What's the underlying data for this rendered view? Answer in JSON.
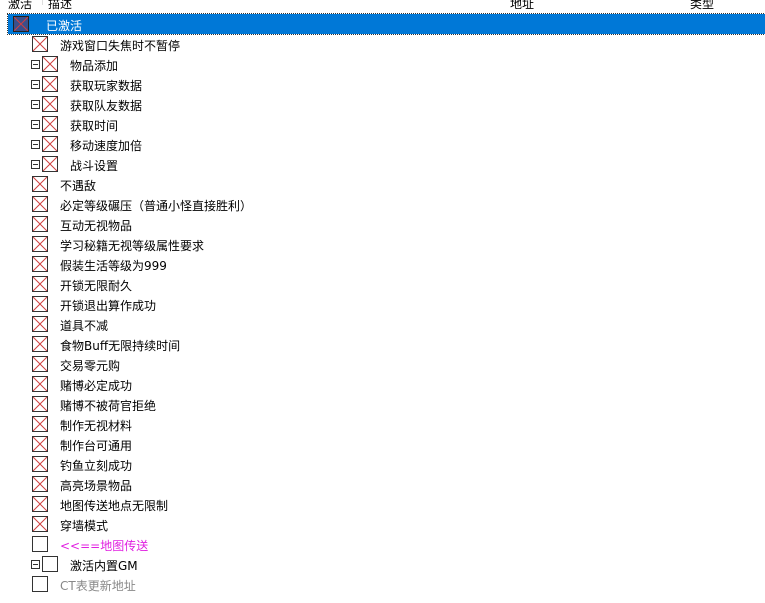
{
  "columns": {
    "active": "激活",
    "description": "描述",
    "address": "地址",
    "type": "类型"
  },
  "rows": [
    {
      "label": "已激活",
      "level": 0,
      "checked": true,
      "selected": true
    },
    {
      "label": "游戏窗口失焦时不暂停",
      "level": 1,
      "checked": true
    },
    {
      "label": "物品添加",
      "level": 1,
      "checked": true,
      "group": true
    },
    {
      "label": "获取玩家数据",
      "level": 1,
      "checked": true,
      "group": true
    },
    {
      "label": "获取队友数据",
      "level": 1,
      "checked": true,
      "group": true
    },
    {
      "label": "获取时间",
      "level": 1,
      "checked": true,
      "group": true
    },
    {
      "label": "移动速度加倍",
      "level": 1,
      "checked": true,
      "group": true
    },
    {
      "label": "战斗设置",
      "level": 1,
      "checked": true,
      "group": true
    },
    {
      "label": "不遇敌",
      "level": 1,
      "checked": true
    },
    {
      "label": "必定等级碾压（普通小怪直接胜利）",
      "level": 1,
      "checked": true
    },
    {
      "label": "互动无视物品",
      "level": 1,
      "checked": true
    },
    {
      "label": "学习秘籍无视等级属性要求",
      "level": 1,
      "checked": true
    },
    {
      "label": "假装生活等级为999",
      "level": 1,
      "checked": true
    },
    {
      "label": "开锁无限耐久",
      "level": 1,
      "checked": true
    },
    {
      "label": "开锁退出算作成功",
      "level": 1,
      "checked": true
    },
    {
      "label": "道具不减",
      "level": 1,
      "checked": true
    },
    {
      "label": "食物Buff无限持续时间",
      "level": 1,
      "checked": true
    },
    {
      "label": "交易零元购",
      "level": 1,
      "checked": true
    },
    {
      "label": "赌博必定成功",
      "level": 1,
      "checked": true
    },
    {
      "label": "赌博不被荷官拒绝",
      "level": 1,
      "checked": true
    },
    {
      "label": "制作无视材料",
      "level": 1,
      "checked": true
    },
    {
      "label": "制作台可通用",
      "level": 1,
      "checked": true
    },
    {
      "label": "钓鱼立刻成功",
      "level": 1,
      "checked": true
    },
    {
      "label": "高亮场景物品",
      "level": 1,
      "checked": true
    },
    {
      "label": "地图传送地点无限制",
      "level": 1,
      "checked": true
    },
    {
      "label": "穿墙模式",
      "level": 1,
      "checked": true
    },
    {
      "label": "<<==地图传送",
      "level": 1,
      "checked": false,
      "color": "#e020e0"
    },
    {
      "label": "激活内置GM",
      "level": 1,
      "checked": false,
      "group": true
    },
    {
      "label": "CT表更新地址",
      "level": 1,
      "checked": false,
      "color": "#888888"
    }
  ]
}
